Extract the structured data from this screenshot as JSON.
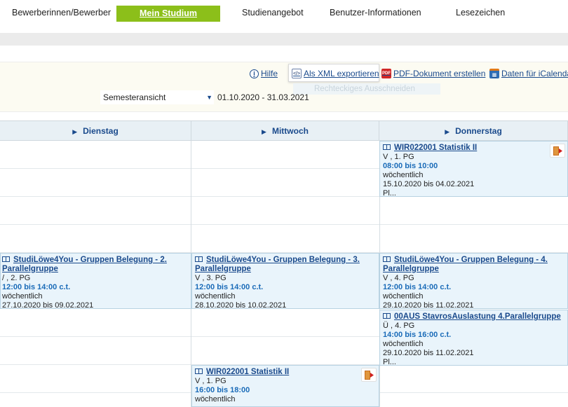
{
  "nav": {
    "items": [
      "Bewerberinnen/Bewerber",
      "Studienangebot",
      "Benutzer-Informationen",
      "Lesezeichen"
    ],
    "active": "Mein Studium"
  },
  "toolbar": {
    "help": "Hilfe",
    "xml": "Als XML exportieren",
    "pdf": "PDF-Dokument erstellen",
    "ical": "Daten für iCalenda",
    "ghost": "Rechteckiges Ausschneiden",
    "select_value": "Semesteransicht",
    "daterange": "01.10.2020 - 31.03.2021"
  },
  "days": [
    "Dienstag",
    "Mittwoch",
    "Donnerstag"
  ],
  "events": {
    "thu1": {
      "title": "WIR022001 Statistik II",
      "type": "V , 1. PG",
      "time": "08:00 bis 10:00",
      "freq": "wöchentlich",
      "range": "15.10.2020 bis 04.02.2021",
      "extra": "Pl..."
    },
    "tue1": {
      "title": "StudiLöwe4You - Gruppen Belegung - 2. Parallelgruppe",
      "type": "/ , 2. PG",
      "time": "12:00 bis 14:00 c.t.",
      "freq": "wöchentlich",
      "range": "27.10.2020 bis 09.02.2021"
    },
    "wed1": {
      "title": "StudiLöwe4You - Gruppen Belegung - 3. Parallelgruppe",
      "type": "V , 3. PG",
      "time": "12:00 bis 14:00 c.t.",
      "freq": "wöchentlich",
      "range": "28.10.2020 bis 10.02.2021"
    },
    "thu2": {
      "title": "StudiLöwe4You - Gruppen Belegung - 4. Parallelgruppe",
      "type": "V , 4. PG",
      "time": "12:00 bis 14:00 c.t.",
      "freq": "wöchentlich",
      "range": "29.10.2020 bis 11.02.2021"
    },
    "thu3": {
      "title": "00AUS StavrosAuslastung 4.Parallelgruppe",
      "type": "Ü , 4. PG",
      "time": "14:00 bis 16:00 c.t.",
      "freq": "wöchentlich",
      "range": "29.10.2020 bis 11.02.2021",
      "extra": "Pl..."
    },
    "wed2": {
      "title": "WIR022001 Statistik II",
      "type": "V , 1. PG",
      "time": "16:00 bis 18:00",
      "freq": "wöchentlich"
    }
  }
}
